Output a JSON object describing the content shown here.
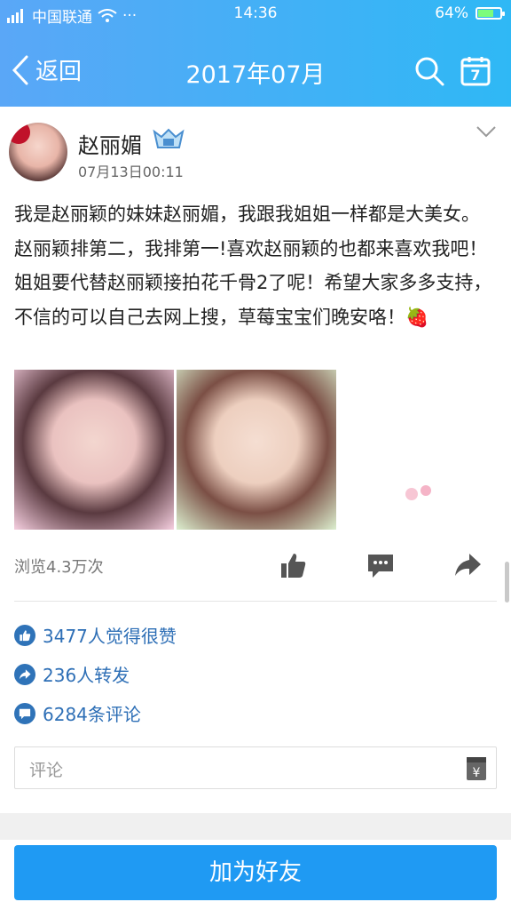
{
  "status_bar": {
    "carrier": "中国联通",
    "time": "14:36",
    "battery_percent": "64%",
    "battery_level": 0.64
  },
  "header": {
    "back_label": "返回",
    "title": "2017年07月",
    "calendar_day": "7"
  },
  "post": {
    "username": "赵丽媚",
    "time": "07月13日00:11",
    "text": "我是赵丽颖的妹妹赵丽媚，我跟我姐姐一样都是大美女。赵丽颖排第二，我排第一!喜欢赵丽颖的也都来喜欢我吧！姐姐要代替赵丽颖接拍花千骨2了呢！希望大家多多支持，不信的可以自己去网上搜，草莓宝宝们晚安咯！🍓",
    "views": "浏览4.3万次"
  },
  "summary": {
    "likes": "3477人觉得很赞",
    "shares": "236人转发",
    "comments": "6284条评论"
  },
  "comment_input": {
    "placeholder": "评论"
  },
  "footer": {
    "add_friend": "加为好友"
  },
  "colors": {
    "accent": "#1f9af3",
    "header_start": "#5aa7f7",
    "header_end": "#2fb8f5",
    "link": "#2e6fb6"
  }
}
